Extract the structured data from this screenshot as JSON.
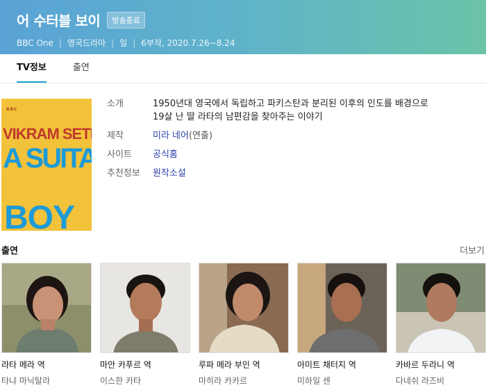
{
  "header": {
    "title": "어 수터블 보이",
    "badge": "방송종료",
    "channel": "BBC One",
    "genre": "영국드라마",
    "day": "일",
    "episodes": "6부작, 2020.7.26~8.24"
  },
  "tabs": [
    {
      "label": "TV정보"
    },
    {
      "label": "출연"
    }
  ],
  "poster": {
    "bbc": "BBC",
    "author": "VIKRAM SETH",
    "title_line1": "A SUITABLE",
    "title_line2": "BOY"
  },
  "info": {
    "intro_label": "소개",
    "intro_text1": "1950년대 영국에서 독립하고 파키스탄과 분리된 이후의 인도를 배경으로",
    "intro_text2": "19살 난 딸 라타의 남편감을 찾아주는 이야기",
    "producer_label": "제작",
    "producer_name": "미라 네어",
    "producer_role": "(연출)",
    "site_label": "사이트",
    "site_value": "공식홈",
    "recommend_label": "추천정보",
    "recommend_value": "원작소설"
  },
  "cast": {
    "title": "출연",
    "more": "더보기",
    "items": [
      {
        "role": "라타 메라 역",
        "actor": "타냐 마닉탈라"
      },
      {
        "role": "마안 카푸르 역",
        "actor": "이스한 카타"
      },
      {
        "role": "루파 메라 부인 역",
        "actor": "마히라 카카르"
      },
      {
        "role": "아미트 채터지 역",
        "actor": "미하일 센"
      },
      {
        "role": "카바르 두라니 역",
        "actor": "다네쉬 라즈비"
      }
    ]
  }
}
